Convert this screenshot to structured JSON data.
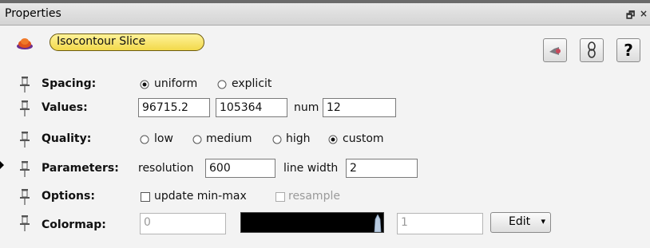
{
  "window": {
    "title": "Properties",
    "float_glyph": "🗗",
    "close_glyph": "×"
  },
  "header": {
    "module_icon": "module-icon",
    "module_name": "Isocontour Slice",
    "buttons": [
      {
        "name": "visibility-button",
        "icon": "eye-icon"
      },
      {
        "name": "link-button",
        "icon": "chain-icon"
      },
      {
        "name": "help-button",
        "label": "?"
      }
    ]
  },
  "rows": {
    "spacing": {
      "label": "Spacing:",
      "options": [
        "uniform",
        "explicit"
      ],
      "selected": "uniform"
    },
    "values": {
      "label": "Values:",
      "min": "96715.2",
      "max": "105364",
      "num_label": "num",
      "num": "12"
    },
    "quality": {
      "label": "Quality:",
      "options": [
        "low",
        "medium",
        "high",
        "custom"
      ],
      "selected": "custom"
    },
    "parameters": {
      "label": "Parameters:",
      "resolution_label": "resolution",
      "resolution": "600",
      "linewidth_label": "line width",
      "linewidth": "2"
    },
    "options": {
      "label": "Options:",
      "update_minmax_label": "update min-max",
      "update_minmax_checked": false,
      "resample_label": "resample",
      "resample_checked": false,
      "resample_enabled": false
    },
    "colormap": {
      "label": "Colormap:",
      "min": "0",
      "max": "1",
      "edit_label": "Edit",
      "edit_arrow": "▾",
      "bar_color": "#000000"
    }
  },
  "colors": {
    "pill_fill": "#f2d94a",
    "panel_bg": "#f3f3f3"
  }
}
